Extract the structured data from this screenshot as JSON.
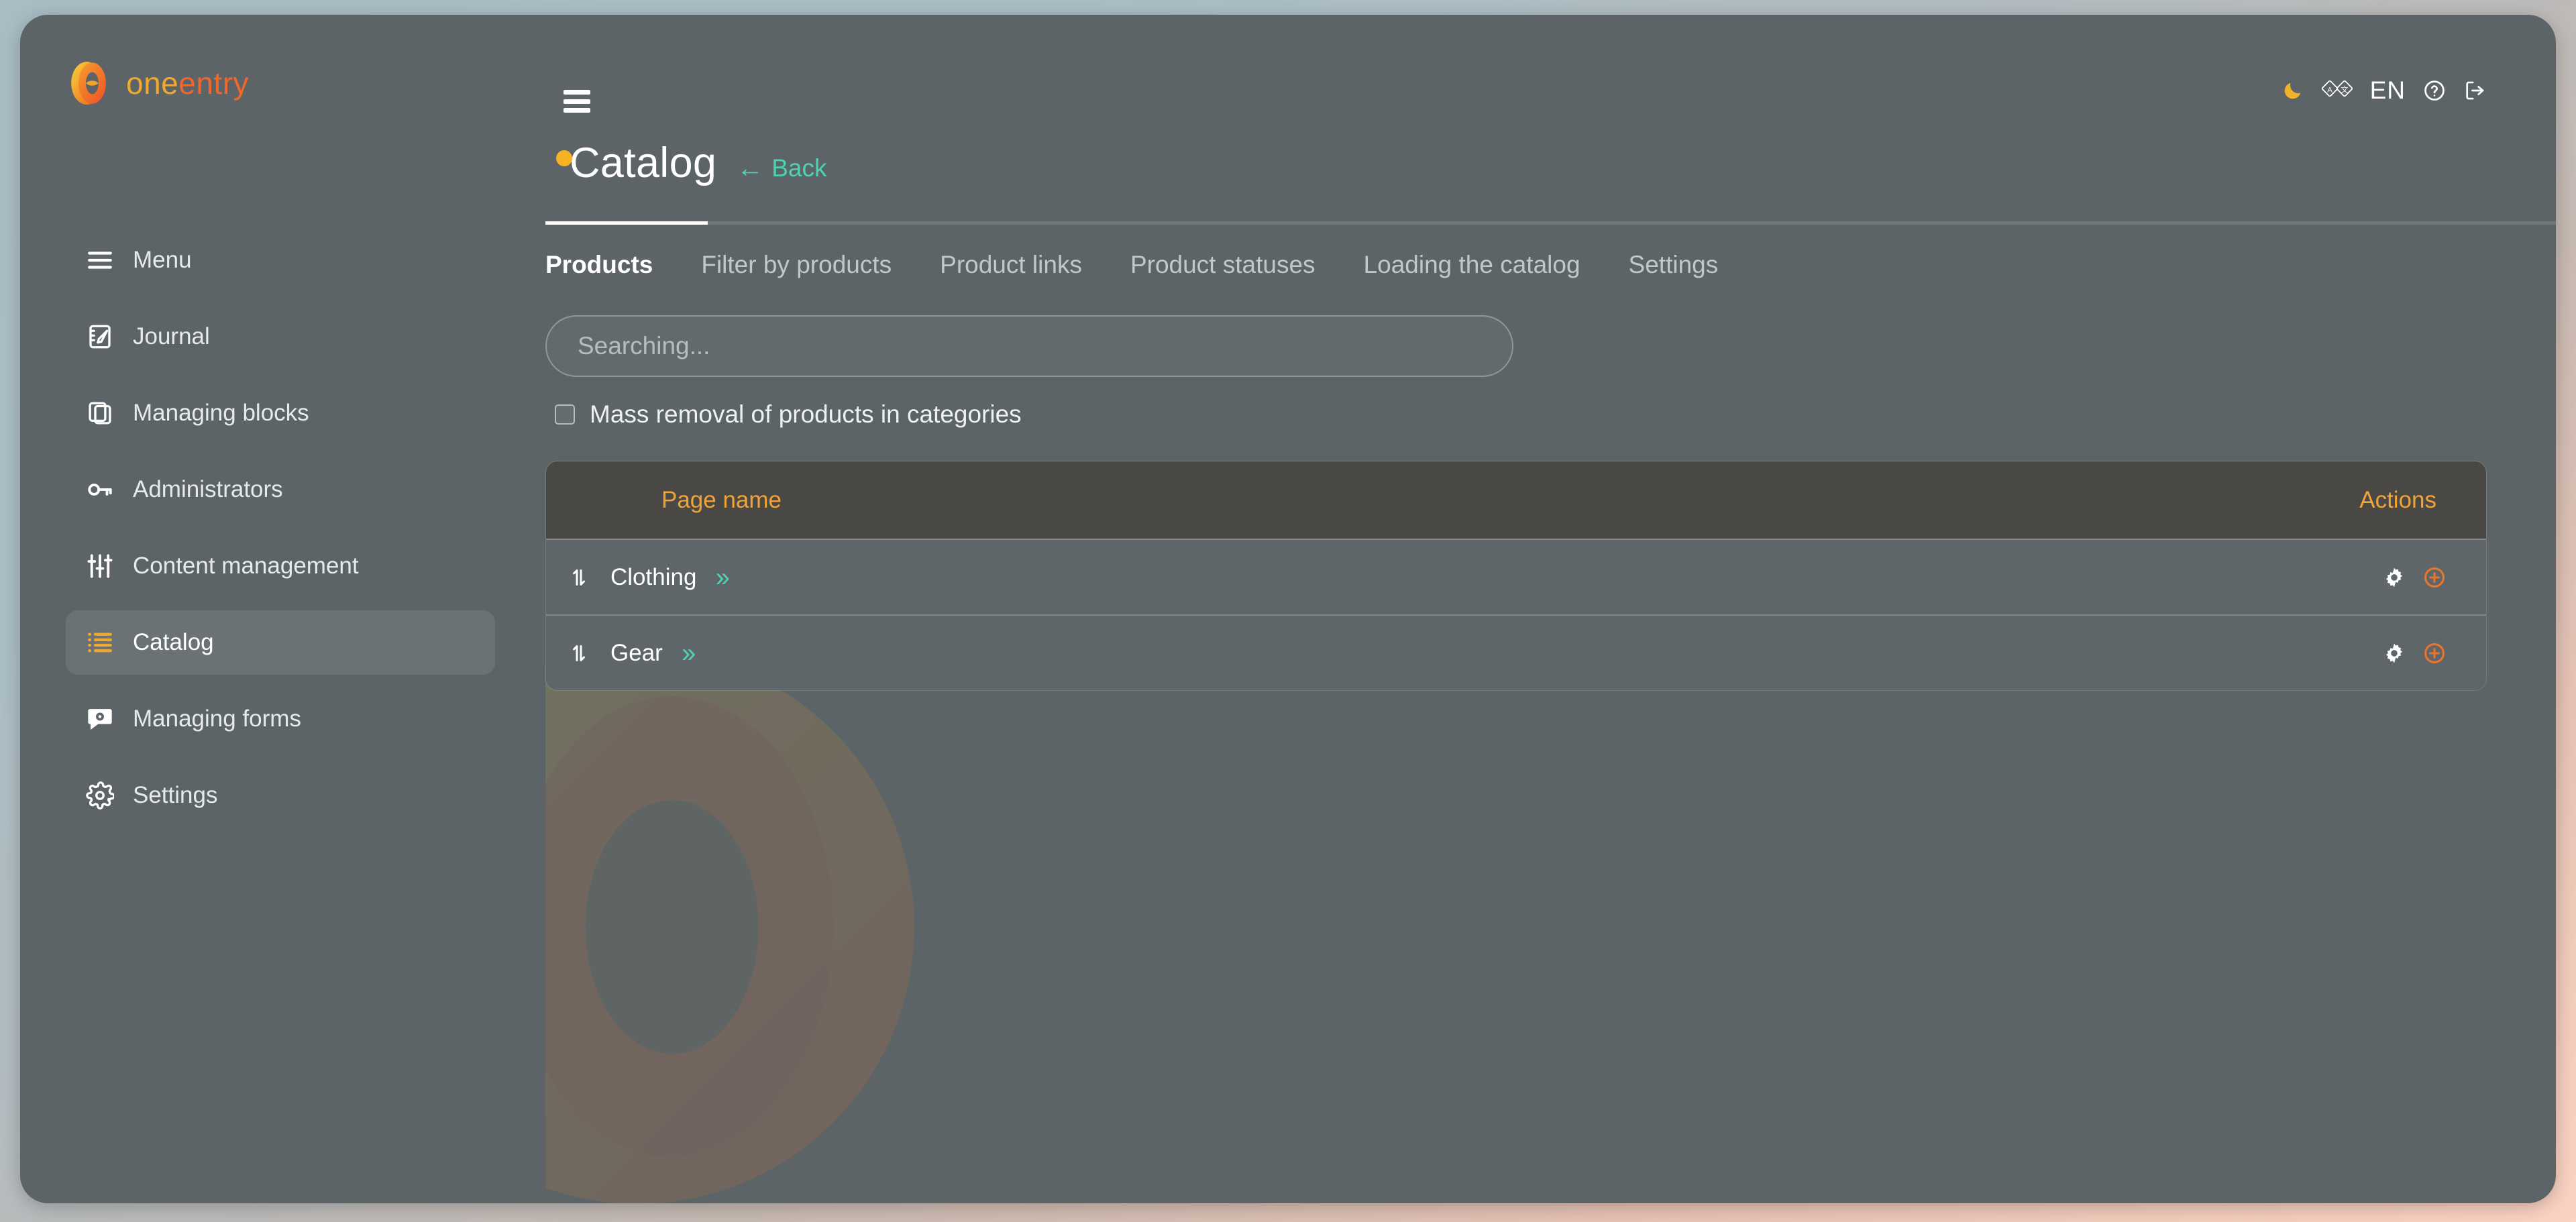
{
  "brand": {
    "name_part1": "one",
    "name_part2": "entry",
    "logo_icon": "oneentry-ring-logo"
  },
  "topbar": {
    "menu_toggle_icon": "hamburger-icon",
    "theme_toggle_icon": "moon-icon",
    "translate_icon": "translate-icon",
    "language": "EN",
    "help_icon": "help-circle-icon",
    "logout_icon": "logout-icon"
  },
  "sidebar": {
    "items": [
      {
        "label": "Menu",
        "icon": "hamburger-menu-icon",
        "active": false
      },
      {
        "label": "Journal",
        "icon": "journal-notebook-icon",
        "active": false
      },
      {
        "label": "Managing blocks",
        "icon": "copy-blocks-icon",
        "active": false
      },
      {
        "label": "Administrators",
        "icon": "key-icon",
        "active": false
      },
      {
        "label": "Content management",
        "icon": "sliders-icon",
        "active": false
      },
      {
        "label": "Catalog",
        "icon": "list-bullet-icon",
        "active": true
      },
      {
        "label": "Managing forms",
        "icon": "chat-gear-icon",
        "active": false
      },
      {
        "label": "Settings",
        "icon": "gear-icon",
        "active": false
      }
    ]
  },
  "page": {
    "title": "Catalog",
    "status_dot_color": "#f5b223",
    "back_label": "Back",
    "back_arrow": "←"
  },
  "tabs": [
    {
      "label": "Products",
      "active": true
    },
    {
      "label": "Filter by products",
      "active": false
    },
    {
      "label": "Product links",
      "active": false
    },
    {
      "label": "Product statuses",
      "active": false
    },
    {
      "label": "Loading the catalog",
      "active": false
    },
    {
      "label": "Settings",
      "active": false
    }
  ],
  "search": {
    "value": "",
    "placeholder": "Searching..."
  },
  "mass_removal": {
    "label": "Mass removal of products in categories",
    "checked": false
  },
  "table": {
    "columns": [
      "Page name",
      "Actions"
    ],
    "header_name": "Page name",
    "header_actions": "Actions",
    "rows": [
      {
        "name": "Clothing",
        "handle_icon": "sort-updown-icon",
        "expand_icon": "double-chevron-right-icon",
        "expand_glyph": "››",
        "actions": [
          "gear-icon",
          "add-circle-icon"
        ]
      },
      {
        "name": "Gear",
        "handle_icon": "sort-updown-icon",
        "expand_icon": "double-chevron-right-icon",
        "expand_glyph": "››",
        "actions": [
          "gear-icon",
          "add-circle-icon"
        ]
      }
    ]
  },
  "colors": {
    "accent_orange": "#efa43a",
    "accent_teal": "#4fd1b6",
    "brand_orange": "#f0662b",
    "brand_yellow": "#f0a92b",
    "app_background": "#5c6467",
    "table_header": "#4a4844"
  }
}
